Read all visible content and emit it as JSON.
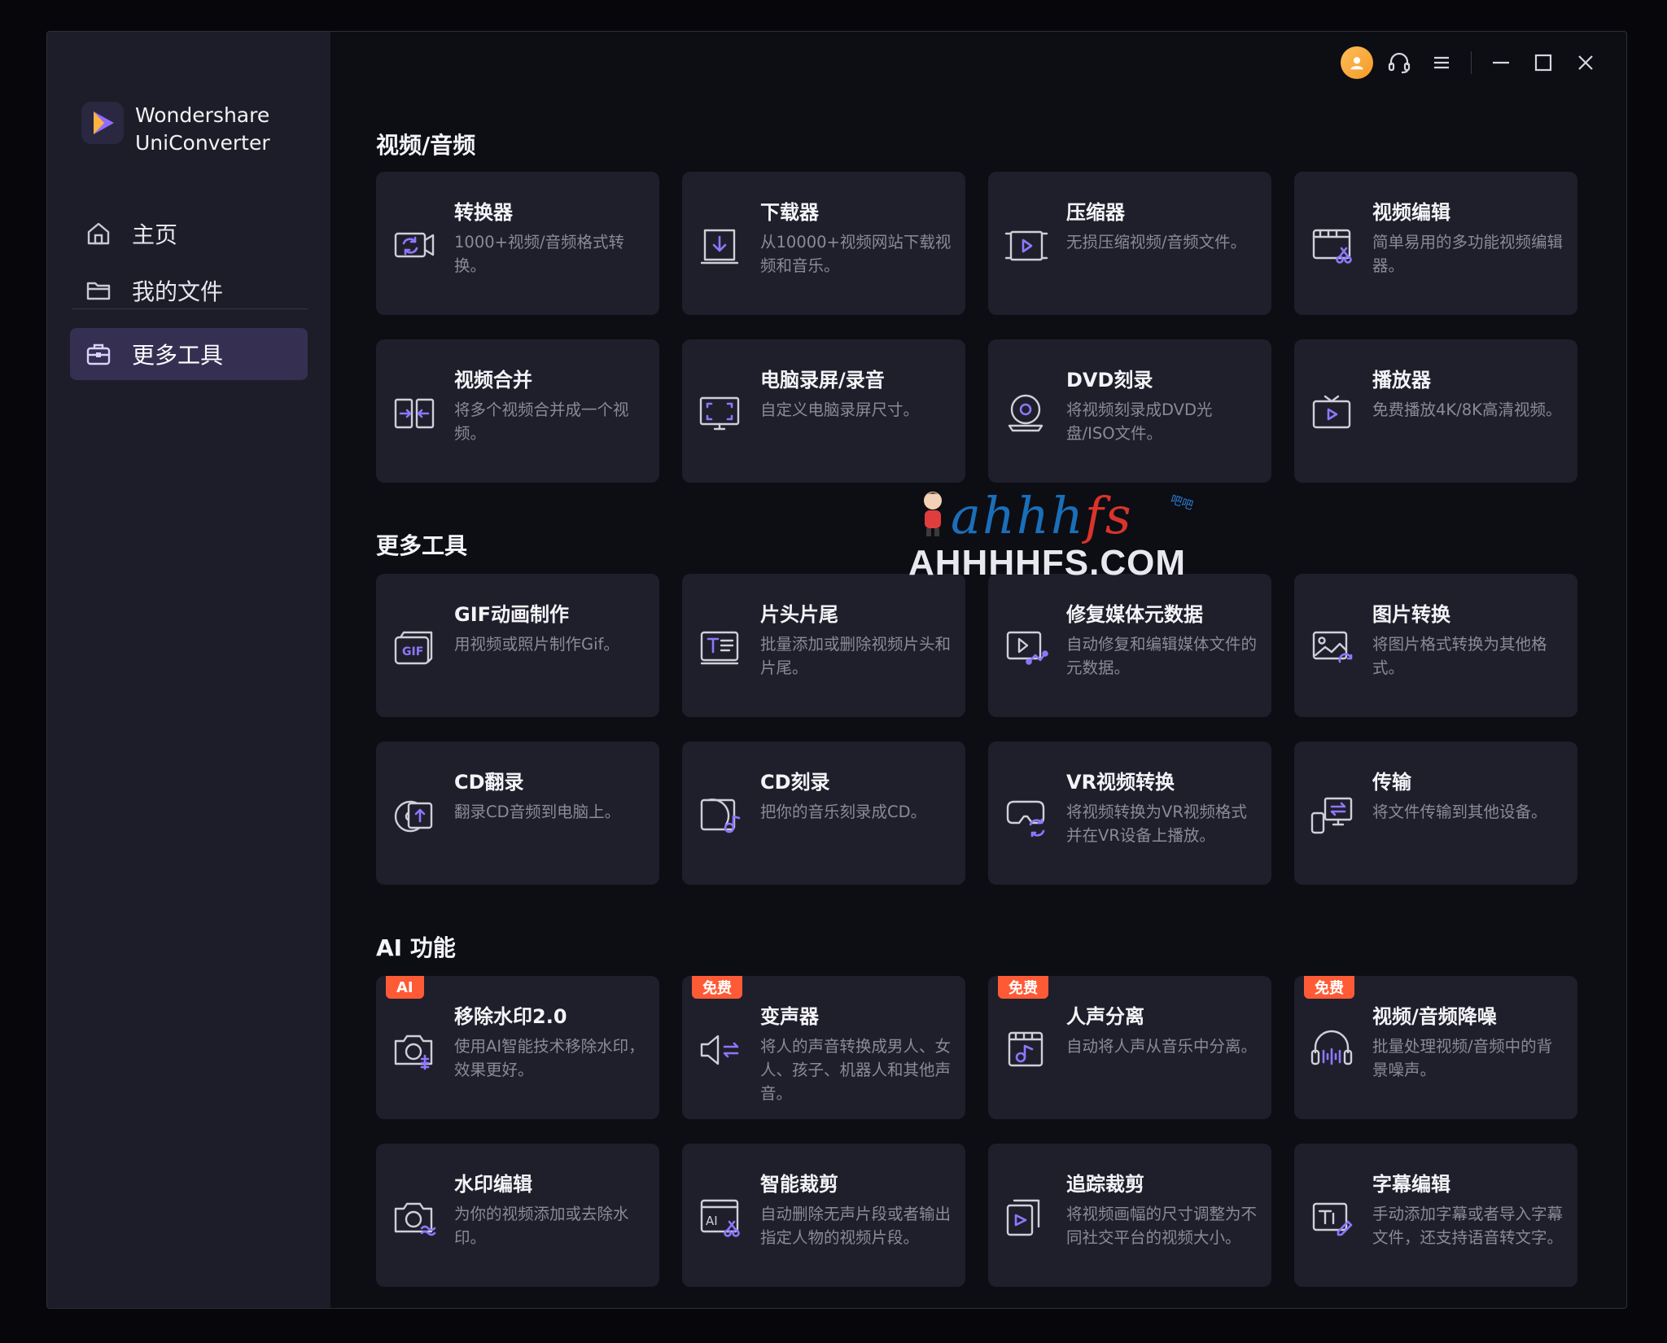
{
  "app": {
    "name_line1": "Wondershare",
    "name_line2": "UniConverter"
  },
  "sidebar": {
    "items": [
      {
        "label": "主页",
        "icon": "home-icon"
      },
      {
        "label": "我的文件",
        "icon": "folder-icon"
      },
      {
        "label": "更多工具",
        "icon": "toolbox-icon",
        "active": true
      }
    ]
  },
  "titlebar": {
    "icons": [
      "user-avatar-icon",
      "headset-icon",
      "menu-icon",
      "minimize-icon",
      "maximize-icon",
      "close-icon"
    ]
  },
  "sections": [
    {
      "title": "视频/音频",
      "cards": [
        {
          "title": "转换器",
          "desc": "1000+视频/音频格式转换。",
          "icon": "converter-icon"
        },
        {
          "title": "下载器",
          "desc": "从10000+视频网站下载视频和音乐。",
          "icon": "downloader-icon"
        },
        {
          "title": "压缩器",
          "desc": "无损压缩视频/音频文件。",
          "icon": "compressor-icon"
        },
        {
          "title": "视频编辑",
          "desc": "简单易用的多功能视频编辑器。",
          "icon": "video-editor-icon"
        },
        {
          "title": "视频合并",
          "desc": "将多个视频合并成一个视频。",
          "icon": "merger-icon"
        },
        {
          "title": "电脑录屏/录音",
          "desc": "自定义电脑录屏尺寸。",
          "icon": "screen-recorder-icon"
        },
        {
          "title": "DVD刻录",
          "desc": "将视频刻录成DVD光盘/ISO文件。",
          "icon": "dvd-burner-icon"
        },
        {
          "title": "播放器",
          "desc": "免费播放4K/8K高清视频。",
          "icon": "player-icon"
        }
      ]
    },
    {
      "title": "更多工具",
      "cards": [
        {
          "title": "GIF动画制作",
          "desc": "用视频或照片制作Gif。",
          "icon": "gif-maker-icon"
        },
        {
          "title": "片头片尾",
          "desc": "批量添加或删除视频片头和片尾。",
          "icon": "intro-outro-icon"
        },
        {
          "title": "修复媒体元数据",
          "desc": "自动修复和编辑媒体文件的元数据。",
          "icon": "metadata-icon"
        },
        {
          "title": "图片转换",
          "desc": "将图片格式转换为其他格式。",
          "icon": "image-converter-icon"
        },
        {
          "title": "CD翻录",
          "desc": "翻录CD音频到电脑上。",
          "icon": "cd-ripper-icon"
        },
        {
          "title": "CD刻录",
          "desc": "把你的音乐刻录成CD。",
          "icon": "cd-burner-icon"
        },
        {
          "title": "VR视频转换",
          "desc": "将视频转换为VR视频格式并在VR设备上播放。",
          "icon": "vr-converter-icon"
        },
        {
          "title": "传输",
          "desc": "将文件传输到其他设备。",
          "icon": "transfer-icon"
        }
      ]
    },
    {
      "title": "AI 功能",
      "cards": [
        {
          "title": "移除水印2.0",
          "desc": "使用AI智能技术移除水印，效果更好。",
          "icon": "watermark-remover-icon",
          "badge": "AI"
        },
        {
          "title": "变声器",
          "desc": "将人的声音转换成男人、女人、孩子、机器人和其他声音。",
          "icon": "voice-changer-icon",
          "badge": "免费"
        },
        {
          "title": "人声分离",
          "desc": "自动将人声从音乐中分离。",
          "icon": "vocal-remover-icon",
          "badge": "免费"
        },
        {
          "title": "视频/音频降噪",
          "desc": "批量处理视频/音频中的背景噪声。",
          "icon": "noise-remover-icon",
          "badge": "免费"
        },
        {
          "title": "水印编辑",
          "desc": "为你的视频添加或去除水印。",
          "icon": "watermark-editor-icon"
        },
        {
          "title": "智能裁剪",
          "desc": "自动删除无声片段或者输出指定人物的视频片段。",
          "icon": "smart-trimmer-icon"
        },
        {
          "title": "追踪裁剪",
          "desc": "将视频画幅的尺寸调整为不同社交平台的视频大小。",
          "icon": "auto-reframe-icon"
        },
        {
          "title": "字幕编辑",
          "desc": "手动添加字幕或者导入字幕文件，还支持语音转文字。",
          "icon": "subtitle-editor-icon"
        }
      ]
    }
  ],
  "watermark": {
    "script_a": "ahhh",
    "script_b": "fs",
    "site": "AHHHHFS.COM",
    "tag": "吧吧"
  },
  "colors": {
    "accent": "#7f66ff",
    "badge": "#ff5a36",
    "card": "#1f1f2b",
    "sidebar": "#1d1d29"
  }
}
